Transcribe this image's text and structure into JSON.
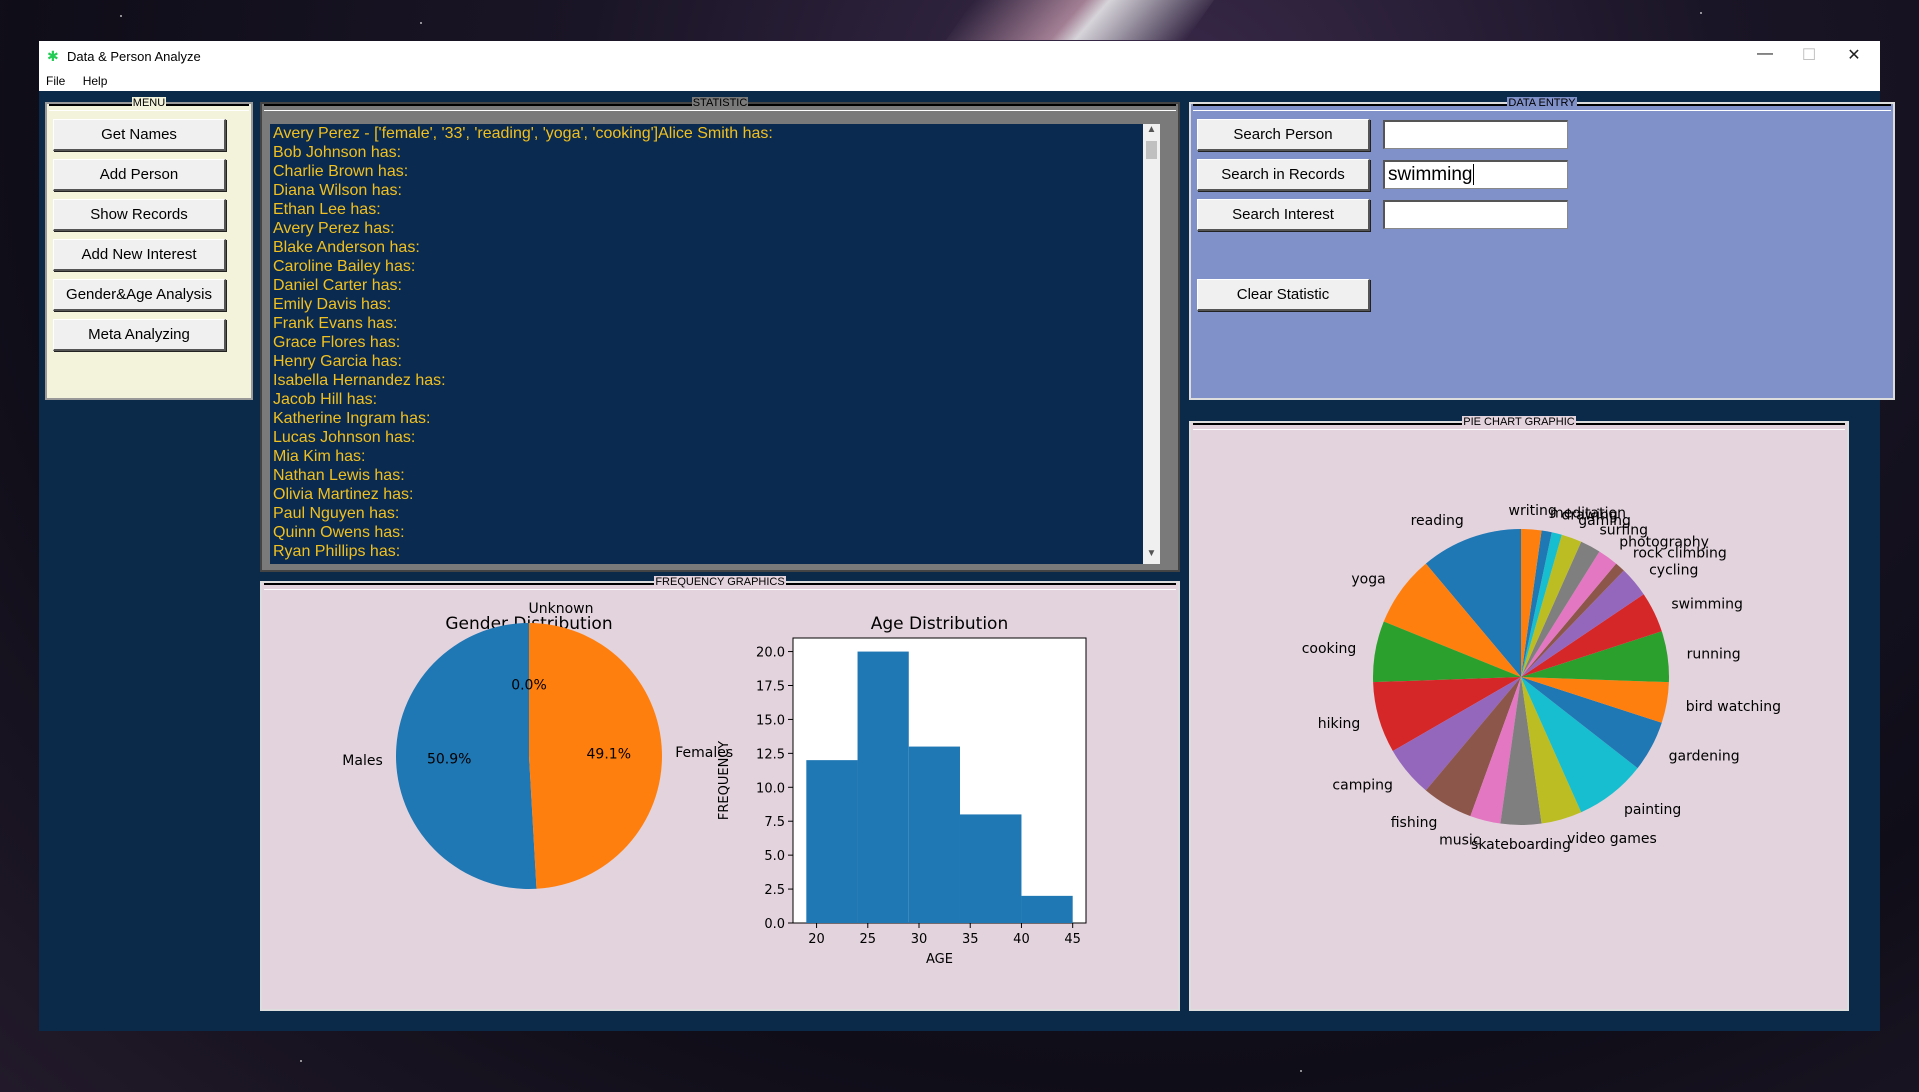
{
  "window": {
    "title": "Data & Person Analyze",
    "minimize": "—",
    "maximize": "☐",
    "close": "✕"
  },
  "menubar": [
    "File",
    "Help"
  ],
  "menu_panel": {
    "legend": "MENU",
    "buttons": [
      "Get Names",
      "Add Person",
      "Show Records",
      "Add New Interest",
      "Gender&Age Analysis",
      "Meta Analyzing"
    ]
  },
  "statistic_panel": {
    "legend": "STATISTIC",
    "lines": [
      "Avery Perez - ['female', '33', 'reading', 'yoga', 'cooking']Alice Smith has:",
      "Bob Johnson has:",
      "Charlie Brown has:",
      "Diana Wilson has:",
      "Ethan Lee has:",
      "Avery Perez has:",
      "Blake Anderson has:",
      "Caroline Bailey has:",
      "Daniel Carter has:",
      "Emily Davis has:",
      "Frank Evans has:",
      "Grace Flores has:",
      "Henry Garcia has:",
      "Isabella Hernandez has:",
      "Jacob Hill has:",
      "Katherine Ingram has:",
      "Lucas Johnson has:",
      "Mia Kim has:",
      "Nathan Lewis has:",
      "Olivia Martinez has:",
      "Paul Nguyen has:",
      "Quinn Owens has:",
      "Ryan Phillips has:"
    ]
  },
  "data_entry": {
    "legend": "DATA ENTRY",
    "search_person_label": "Search Person",
    "search_person_value": "",
    "search_records_label": "Search in Records",
    "search_records_value": "swimming",
    "search_interest_label": "Search Interest",
    "search_interest_value": "",
    "clear_label": "Clear Statistic"
  },
  "frequency_panel": {
    "legend": "FREQUENCY GRAPHICS"
  },
  "pie_panel": {
    "legend": "PIE CHART GRAPHIC"
  },
  "colors": {
    "window_bg": "#0b2a4a",
    "menu_bg": "#f3f3dc",
    "entry_bg": "#8090c8",
    "graph_bg": "#e3d3dd",
    "text_yellow": "#f0c020",
    "palette": [
      "#1f77b4",
      "#ff7f0e",
      "#2ca02c",
      "#d62728",
      "#9467bd",
      "#8c564b",
      "#e377c2",
      "#7f7f7f",
      "#bcbd22",
      "#17becf"
    ]
  },
  "chart_data": [
    {
      "type": "pie",
      "title": "Gender Distribution",
      "labels": [
        "Males",
        "Females",
        "Unknown"
      ],
      "values": [
        50.9,
        49.1,
        0.0
      ],
      "autopct": [
        "50.9%",
        "49.1%",
        "0.0%"
      ]
    },
    {
      "type": "bar",
      "title": "Age Distribution",
      "xlabel": "AGE",
      "ylabel": "FREQUENCY",
      "bins": [
        [
          19,
          24
        ],
        [
          24,
          29
        ],
        [
          29,
          34
        ],
        [
          34,
          40
        ],
        [
          40,
          45
        ]
      ],
      "values": [
        12,
        20,
        13,
        8,
        2
      ],
      "xticks": [
        20,
        25,
        30,
        35,
        40,
        45
      ],
      "yticks": [
        "0.0",
        "2.5",
        "5.0",
        "7.5",
        "10.0",
        "12.5",
        "15.0",
        "17.5",
        "20.0"
      ],
      "xlim": [
        17.7,
        46.3
      ],
      "ylim": [
        0,
        21
      ]
    },
    {
      "type": "pie",
      "title": "",
      "labels": [
        "reading",
        "yoga",
        "cooking",
        "hiking",
        "camping",
        "fishing",
        "music",
        "skateboarding",
        "video games",
        "painting",
        "gardening",
        "bird watching",
        "running",
        "swimming",
        "cycling",
        "rock climbing",
        "photography",
        "surfing",
        "gaming",
        "drawing",
        "meditation",
        "writing"
      ],
      "values": [
        10,
        7,
        6,
        7,
        5,
        5,
        3,
        4,
        4,
        7,
        5,
        4,
        5,
        4,
        3,
        1,
        2,
        2,
        2,
        1,
        1,
        2
      ]
    }
  ]
}
